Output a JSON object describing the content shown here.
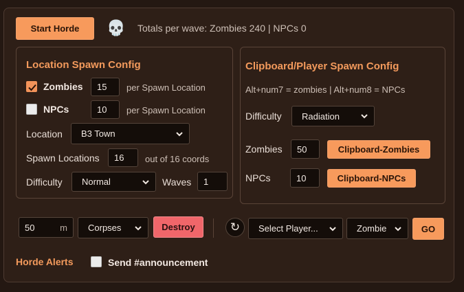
{
  "toolbar": {
    "start_label": "Start Horde",
    "skull": "💀",
    "totals": "Totals per wave: Zombies 240 | NPCs 0"
  },
  "location": {
    "title": "Location Spawn Config",
    "zombies_label": "Zombies",
    "zombies_checked": true,
    "zombies_value": "15",
    "zombies_suffix": "per Spawn Location",
    "npcs_label": "NPCs",
    "npcs_checked": false,
    "npcs_value": "10",
    "npcs_suffix": "per Spawn Location",
    "location_label": "Location",
    "location_value": "B3 Town",
    "spawn_label": "Spawn Locations",
    "spawn_value": "16",
    "spawn_suffix": "out of 16 coords",
    "difficulty_label": "Difficulty",
    "difficulty_value": "Normal",
    "waves_label": "Waves",
    "waves_value": "1"
  },
  "clipboard": {
    "title": "Clipboard/Player Spawn Config",
    "hint": "Alt+num7 = zombies | Alt+num8 = NPCs",
    "difficulty_label": "Difficulty",
    "difficulty_value": "Radiation",
    "zombies_label": "Zombies",
    "zombies_value": "50",
    "zombies_button": "Clipboard-Zombies",
    "npcs_label": "NPCs",
    "npcs_value": "10",
    "npcs_button": "Clipboard-NPCs"
  },
  "destroy_bar": {
    "radius_value": "50",
    "radius_unit": "m",
    "type_value": "Corpses",
    "destroy_label": "Destroy"
  },
  "player_bar": {
    "refresh_glyph": "↻",
    "player_value": "Select Player...",
    "kind_value": "Zombie",
    "go_label": "GO"
  },
  "alerts": {
    "title": "Horde Alerts",
    "checked": false,
    "label": "Send #announcement"
  },
  "colors": {
    "accent": "#f79a5c",
    "danger": "#f0666a",
    "background": "#2e1f17"
  }
}
